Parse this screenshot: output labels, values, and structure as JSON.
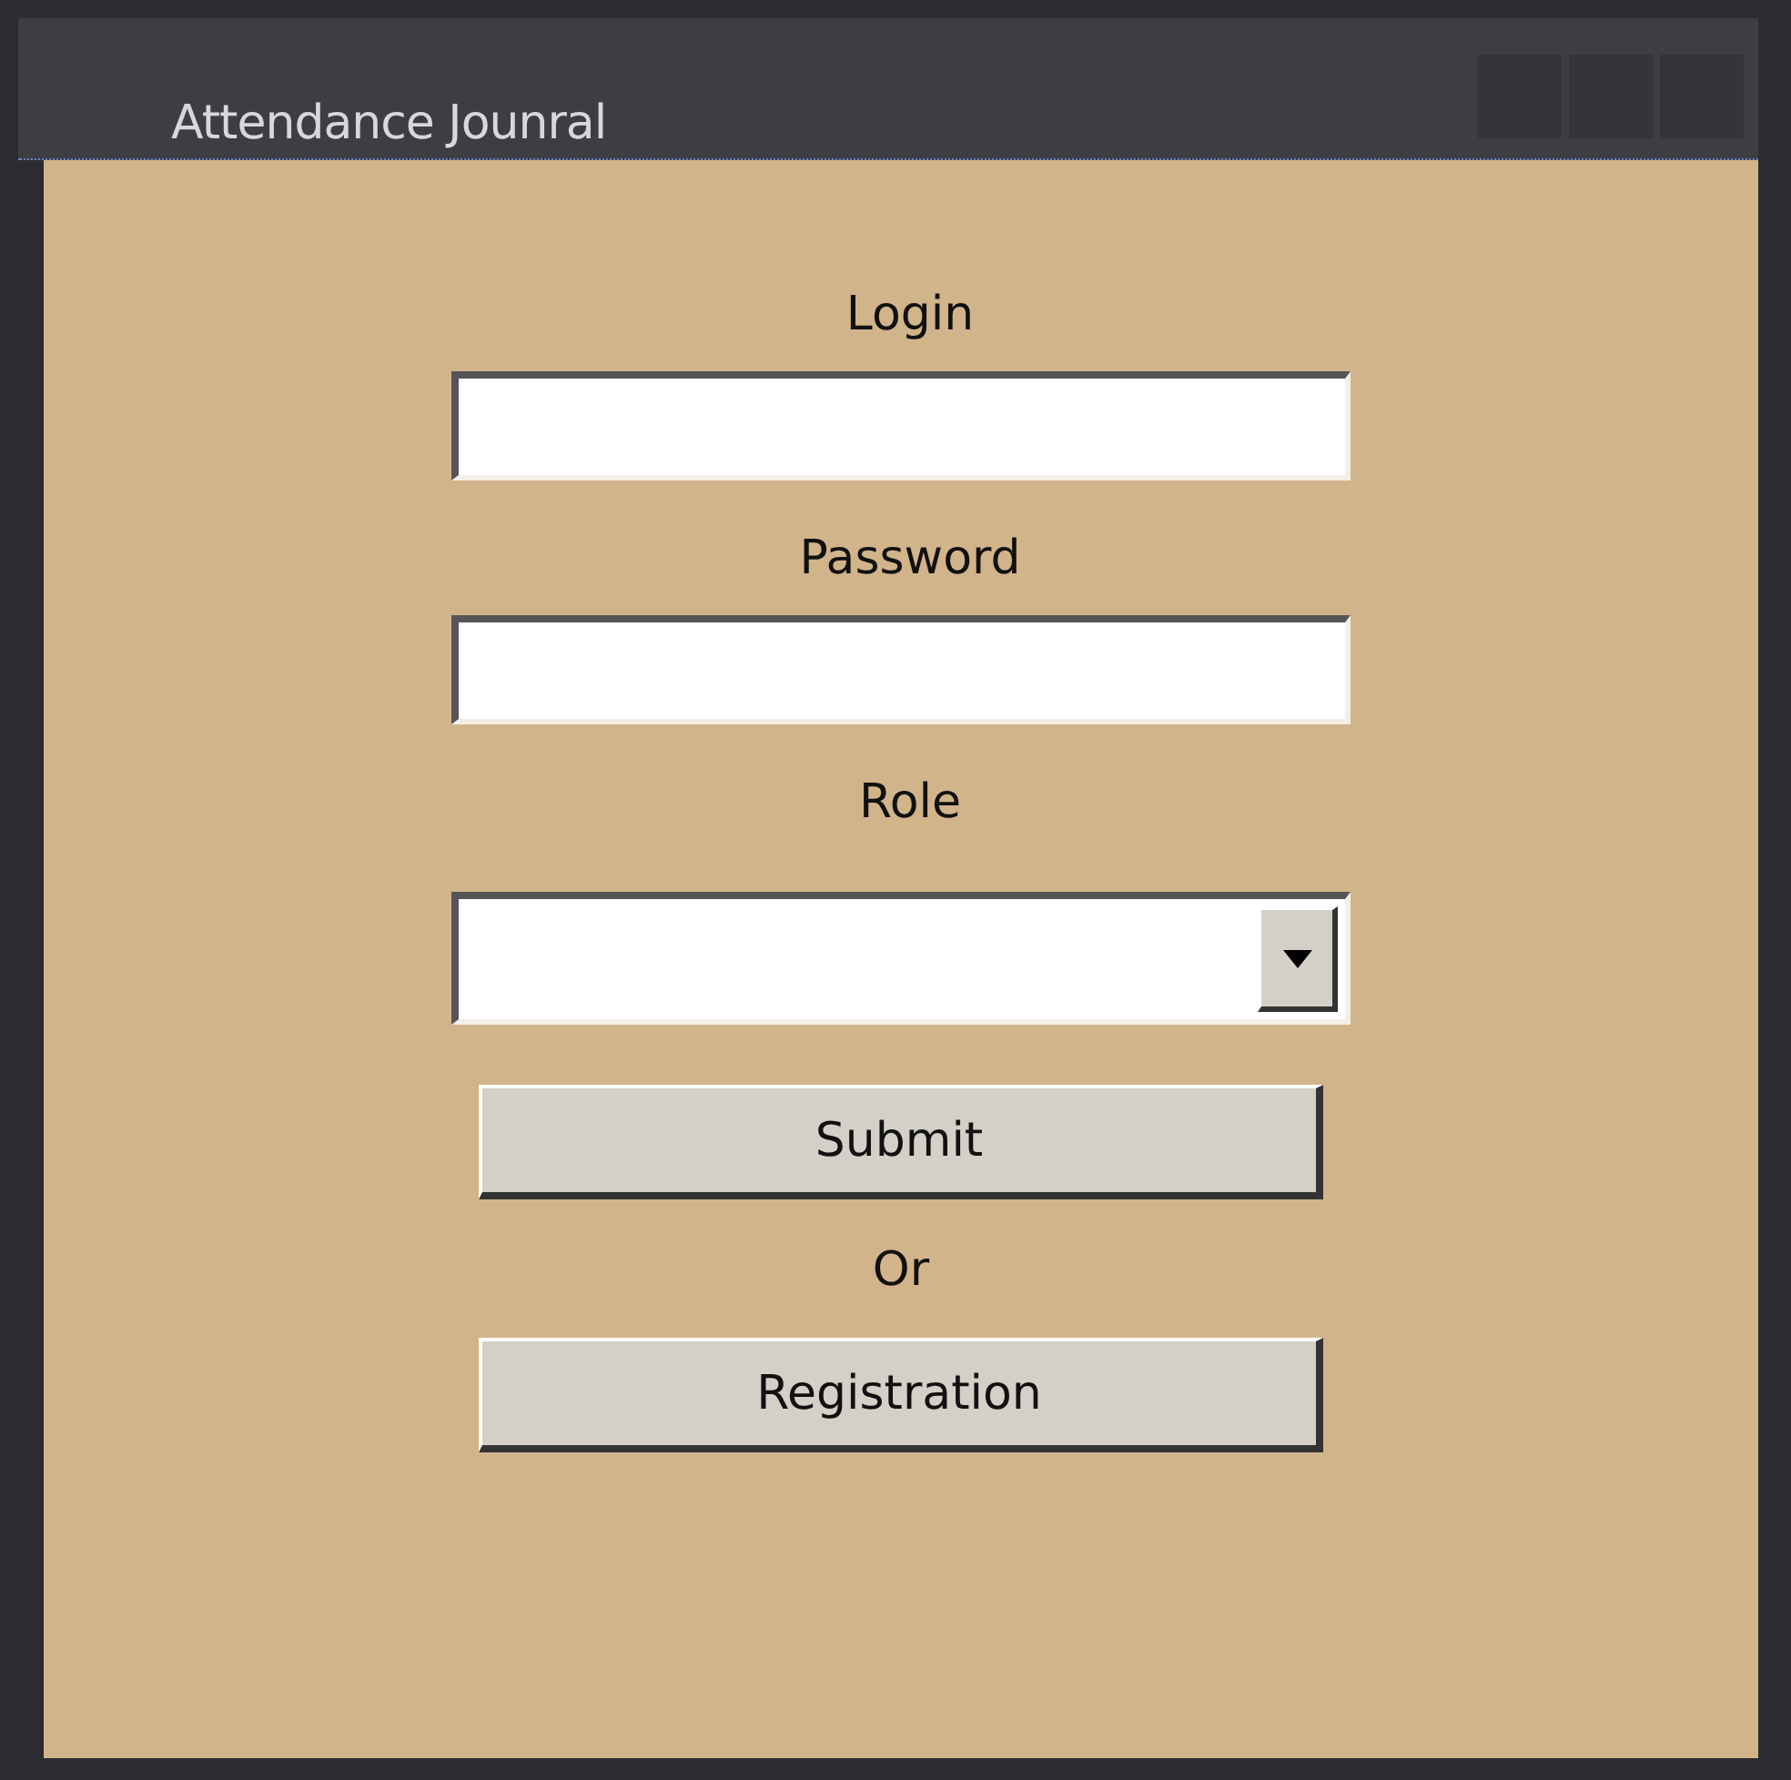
{
  "window": {
    "title": "Attendance Jounral"
  },
  "form": {
    "fields": [
      {
        "label": "Login",
        "kind": "text"
      },
      {
        "label": "Password",
        "kind": "password"
      },
      {
        "label": "Role",
        "kind": "dropdown"
      }
    ],
    "submit": "Submit",
    "separator": "Or",
    "register": "Registration"
  }
}
